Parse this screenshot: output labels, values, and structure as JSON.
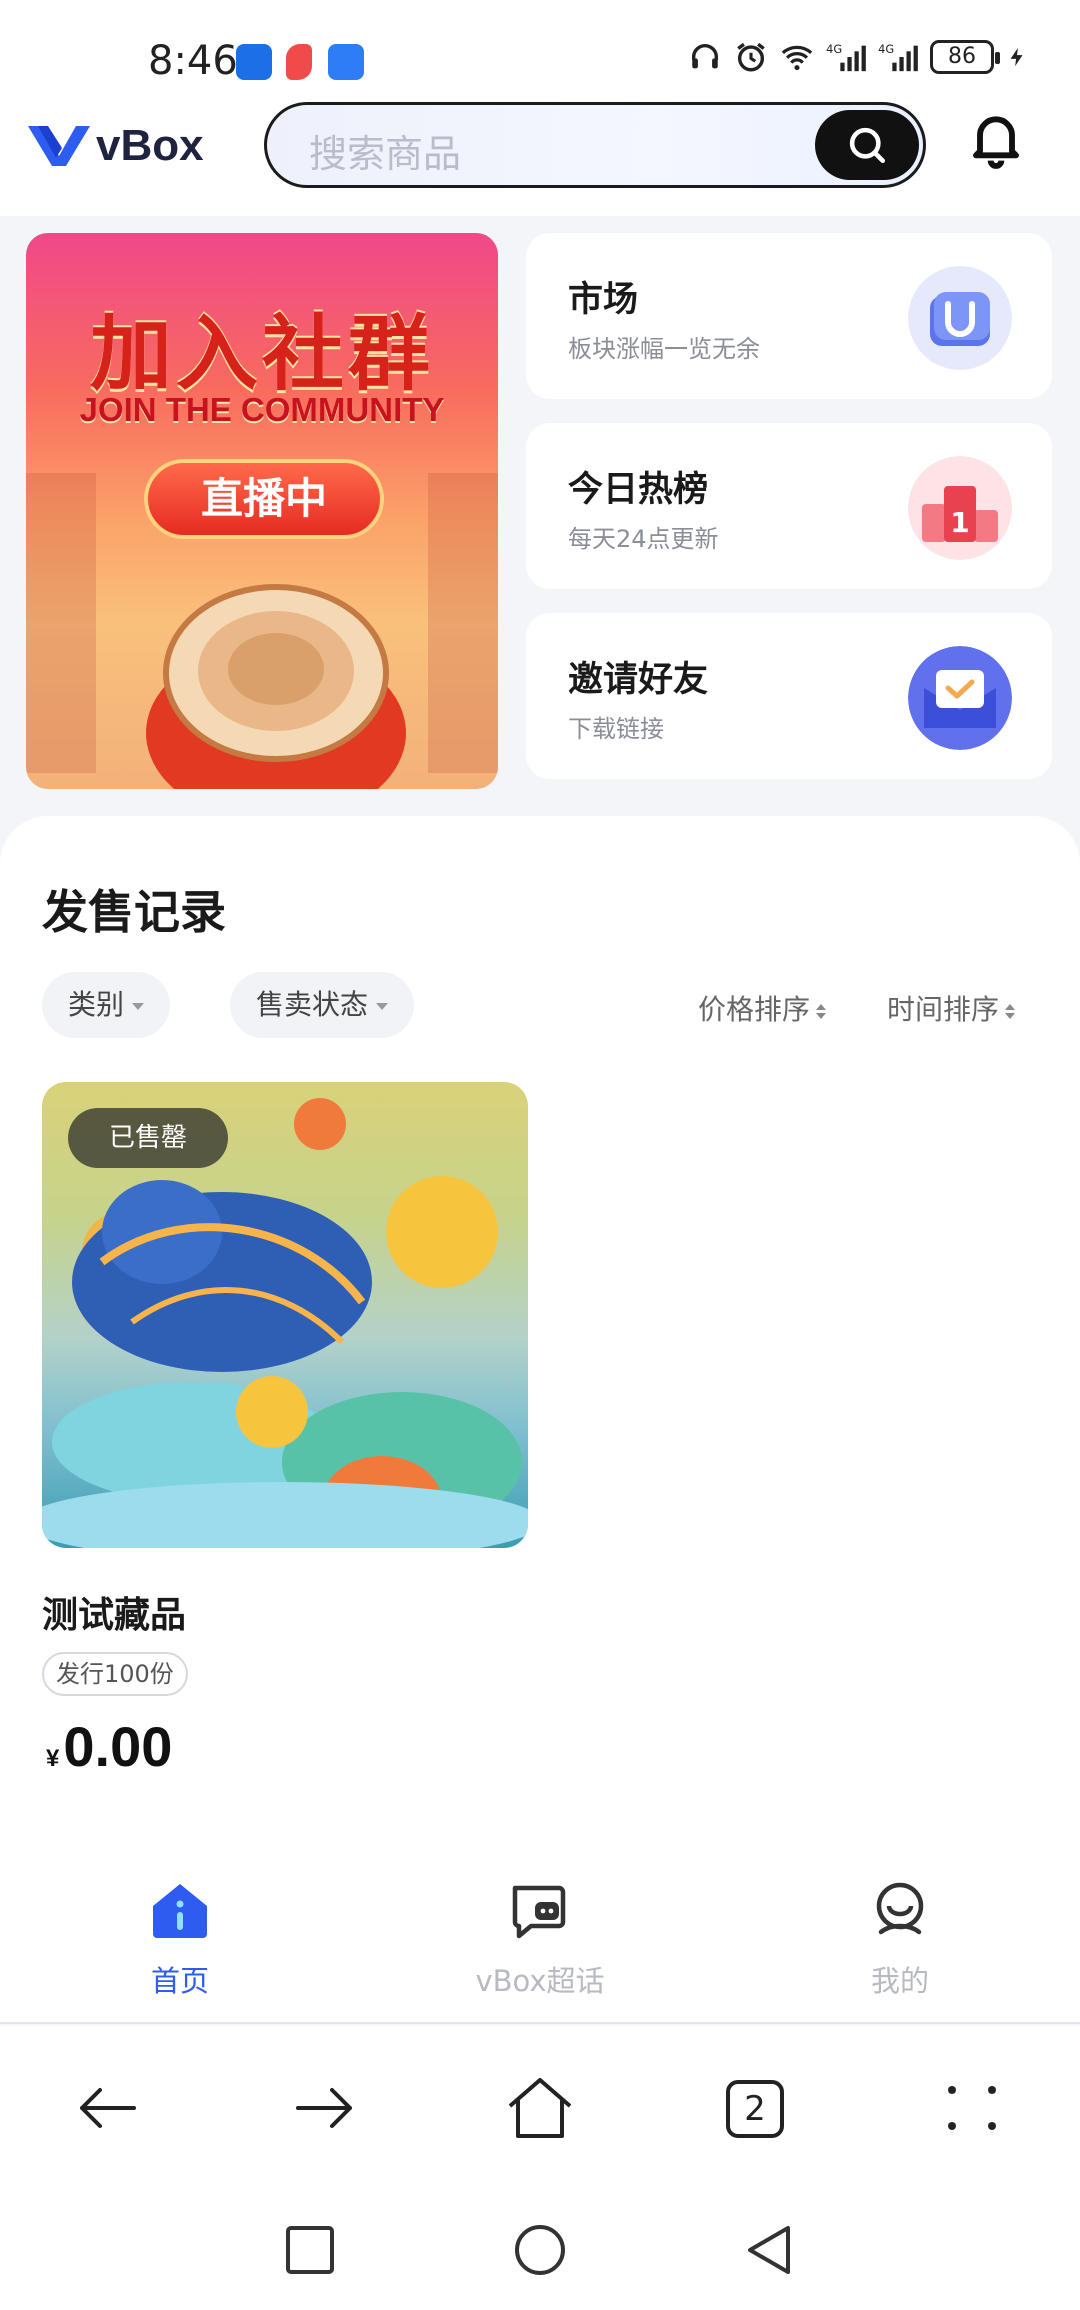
{
  "status_bar": {
    "time": "8:46",
    "battery": "86",
    "icons": [
      "headphones-icon",
      "alarm-icon",
      "wifi-icon",
      "signal-4g-icon",
      "signal-4g-icon",
      "charging-icon"
    ]
  },
  "header": {
    "logo_text": "vBox",
    "search_placeholder": "搜索商品"
  },
  "menu": [
    {
      "title": "市场",
      "subtitle": "板块涨幅一览无余",
      "icon": "market-u-icon"
    },
    {
      "title": "今日热榜",
      "subtitle": "每天24点更新",
      "icon": "ranking-podium-icon"
    },
    {
      "title": "邀请好友",
      "subtitle": "下载链接",
      "icon": "invite-envelope-icon"
    }
  ],
  "banner": {
    "title": "加入社群",
    "subtitle": "JOIN THE COMMUNITY",
    "live_label": "直播中"
  },
  "sales": {
    "title": "发售记录",
    "filters": [
      "类别",
      "售卖状态"
    ],
    "sorts": [
      "价格排序",
      "时间排序"
    ],
    "products": [
      {
        "badge": "已售罄",
        "name": "测试藏品",
        "edition": "发行100份",
        "currency": "¥",
        "price": "0.00"
      }
    ]
  },
  "tabbar": {
    "tabs": [
      {
        "label": "首页",
        "active": true
      },
      {
        "label": "vBox超话",
        "active": false
      },
      {
        "label": "我的",
        "active": false
      }
    ]
  },
  "browser": {
    "tab_count": "2"
  },
  "colors": {
    "accent": "#2f5cf0",
    "text": "#1a1a1a",
    "muted": "#8b8e99"
  }
}
